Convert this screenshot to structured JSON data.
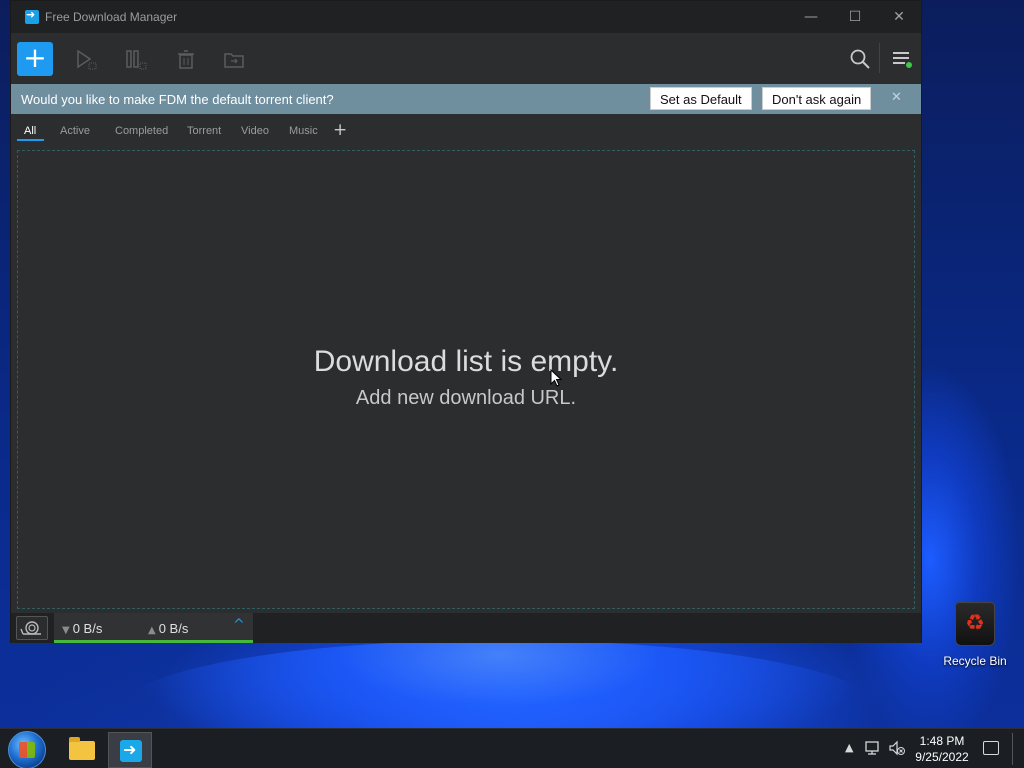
{
  "window": {
    "title": "Free Download Manager",
    "controls": {
      "minimize": "—",
      "maximize": "☐",
      "close": "✕"
    }
  },
  "toolbar": {
    "add_label": "+",
    "icons": [
      "add-download-icon",
      "resume-icon",
      "pause-icon",
      "delete-icon",
      "move-to-folder-icon",
      "search-icon",
      "menu-icon"
    ]
  },
  "notification": {
    "text": "Would you like to make FDM the default torrent client?",
    "set_default_label": "Set as Default",
    "dont_ask_label": "Don't ask again",
    "close": "✕"
  },
  "tabs": [
    {
      "label": "All",
      "active": true
    },
    {
      "label": "Active",
      "active": false
    },
    {
      "label": "Completed",
      "active": false
    },
    {
      "label": "Torrent",
      "active": false
    },
    {
      "label": "Video",
      "active": false
    },
    {
      "label": "Music",
      "active": false
    }
  ],
  "tab_add_label": "+",
  "empty_state": {
    "title": "Download list is empty.",
    "subtitle": "Add new download URL."
  },
  "status": {
    "down_arrow": "▼",
    "down_speed": "0 B/s",
    "up_arrow": "▲",
    "up_speed": "0 B/s",
    "expand": "^"
  },
  "desktop": {
    "recycle_bin_label": "Recycle Bin"
  },
  "taskbar": {
    "time": "1:48 PM",
    "date": "9/25/2022",
    "tray_chevron": "▲"
  },
  "colors": {
    "accent": "#1e9bf0",
    "notify_bar": "#6f8f9f",
    "speed_indicator": "#45b93b",
    "window_bg": "#2b2d2e"
  }
}
